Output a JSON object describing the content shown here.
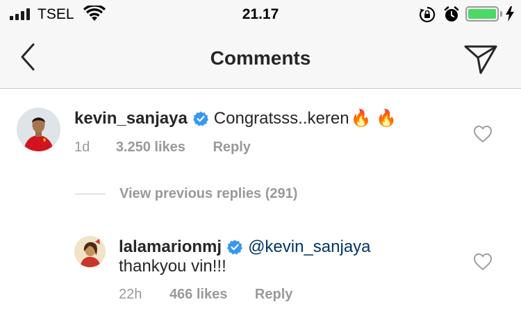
{
  "status_bar": {
    "carrier": "TSEL",
    "time": "21.17",
    "signal_bars": 4,
    "battery_level": 1.0,
    "icons": [
      "signal-icon",
      "wifi-icon",
      "rotation-lock-icon",
      "alarm-icon",
      "battery-icon",
      "charging-bolt-icon"
    ],
    "battery_color": "#4cd964"
  },
  "nav": {
    "title": "Comments",
    "back_icon": "chevron-left-icon",
    "send_icon": "paper-plane-icon"
  },
  "comments": [
    {
      "username": "kevin_sanjaya",
      "verified": true,
      "text": "Congratsss..keren",
      "emoji": "🔥 🔥",
      "time": "1d",
      "likes": "3.250 likes",
      "reply": "Reply"
    }
  ],
  "view_replies": "View previous replies (291)",
  "replies": [
    {
      "username": "lalamarionmj",
      "verified": true,
      "mention": "@kevin_sanjaya",
      "text": "thankyou vin!!!",
      "time": "22h",
      "likes": "466 likes",
      "reply": "Reply"
    }
  ],
  "colors": {
    "verified_blue": "#3897f0",
    "mention": "#003569",
    "meta_gray": "#999999"
  }
}
